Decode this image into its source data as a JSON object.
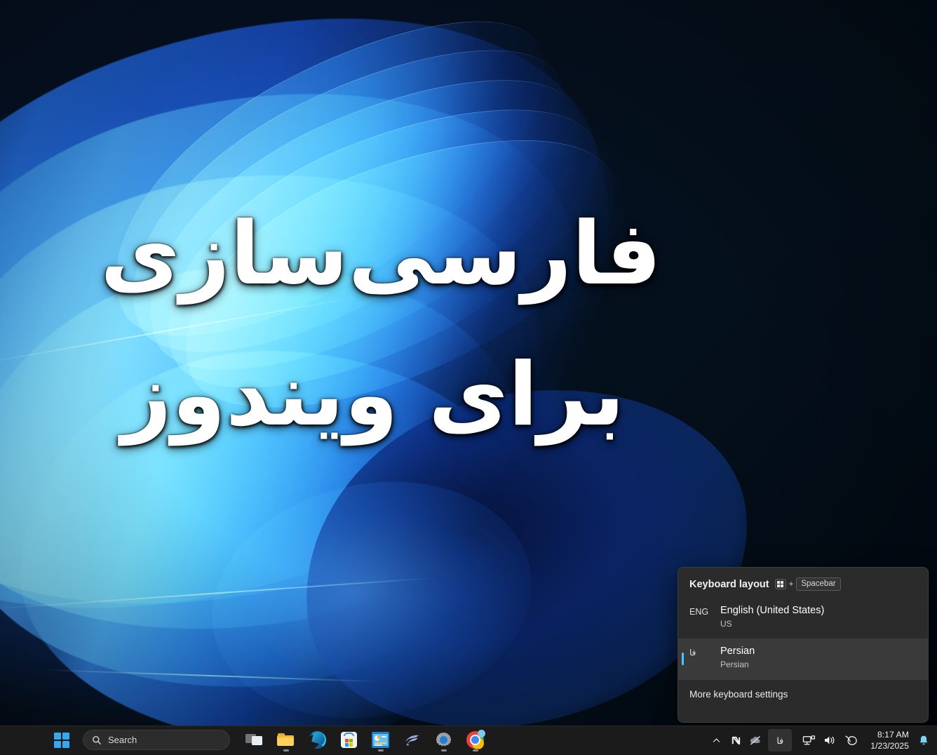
{
  "desktop": {
    "wallpaper_name": "windows-11-bloom-wallpaper",
    "headline_line1": "فارسی‌سازی",
    "headline_line2": "برای ویندوز"
  },
  "keyboard_flyout": {
    "title": "Keyboard layout",
    "shortcut": {
      "win_key": "win-key",
      "plus": "+",
      "key": "Spacebar"
    },
    "accent_color": "#4cc2ff",
    "items": [
      {
        "abbr": "ENG",
        "name": "English (United States)",
        "sub": "US",
        "selected": false
      },
      {
        "abbr": "فا",
        "name": "Persian",
        "sub": "Persian",
        "selected": true
      }
    ],
    "footer_label": "More keyboard settings"
  },
  "taskbar": {
    "start_label": "Start",
    "search": {
      "placeholder": "Search",
      "icon": "search-icon"
    },
    "apps": [
      {
        "name": "Task View",
        "icon": "task-view-icon",
        "running": false
      },
      {
        "name": "File Explorer",
        "icon": "file-explorer-icon",
        "running": true
      },
      {
        "name": "Microsoft Edge",
        "icon": "edge-icon",
        "running": false
      },
      {
        "name": "Microsoft Store",
        "icon": "microsoft-store-icon",
        "running": false
      },
      {
        "name": "Control Panel",
        "icon": "control-panel-icon",
        "running": true
      },
      {
        "name": "Wing App",
        "icon": "wing-logo-icon",
        "running": false
      },
      {
        "name": "Settings",
        "icon": "settings-gear-icon",
        "running": true
      },
      {
        "name": "Google Chrome",
        "icon": "chrome-icon",
        "running": true
      }
    ],
    "tray": {
      "overflow": "chevron-up-icon",
      "icons": [
        {
          "name": "n-app-icon"
        },
        {
          "name": "onedrive-offline-icon"
        }
      ],
      "language_indicator": "فا",
      "status_icons": [
        {
          "name": "network-icon"
        },
        {
          "name": "volume-icon"
        },
        {
          "name": "leaf-eco-icon"
        }
      ],
      "clock_time": "8:17 AM",
      "clock_date": "1/23/2025",
      "notification": "notification-bell-icon"
    }
  }
}
